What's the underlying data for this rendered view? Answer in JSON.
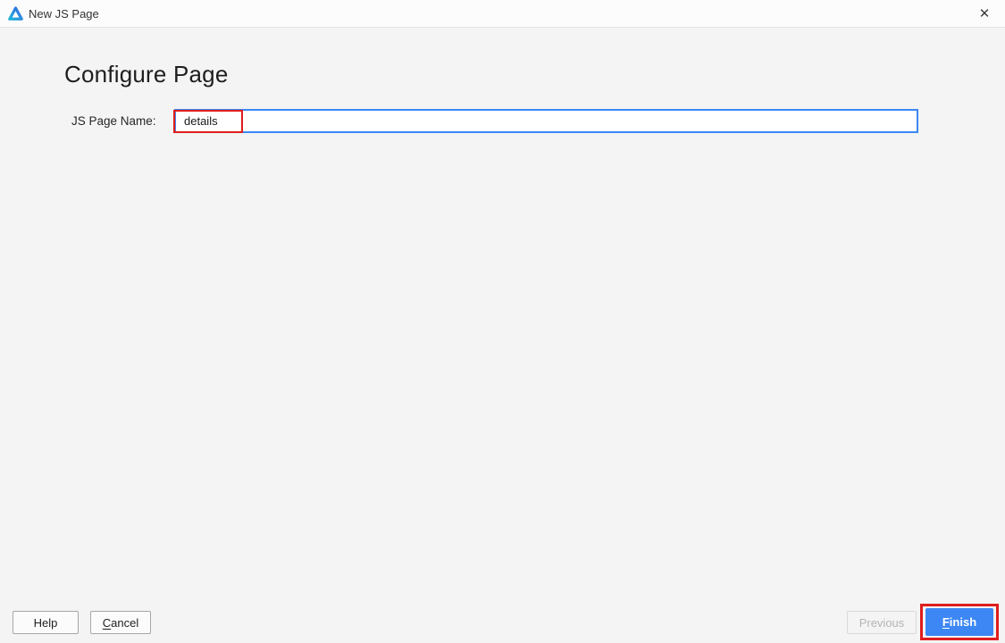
{
  "titlebar": {
    "title": "New JS Page",
    "close_glyph": "✕"
  },
  "content": {
    "heading": "Configure Page",
    "form": {
      "label": "JS Page Name:",
      "value": "details"
    }
  },
  "footer": {
    "help_label": "Help",
    "cancel_mnemonic": "C",
    "cancel_rest": "ancel",
    "previous_label": "Previous",
    "finish_mnemonic": "F",
    "finish_rest": "inish"
  },
  "colors": {
    "accent_blue": "#3c87f4",
    "annotation_red": "#df1d1d",
    "titlebar_bg": "#fcfcfc",
    "body_bg": "#f4f4f4"
  }
}
